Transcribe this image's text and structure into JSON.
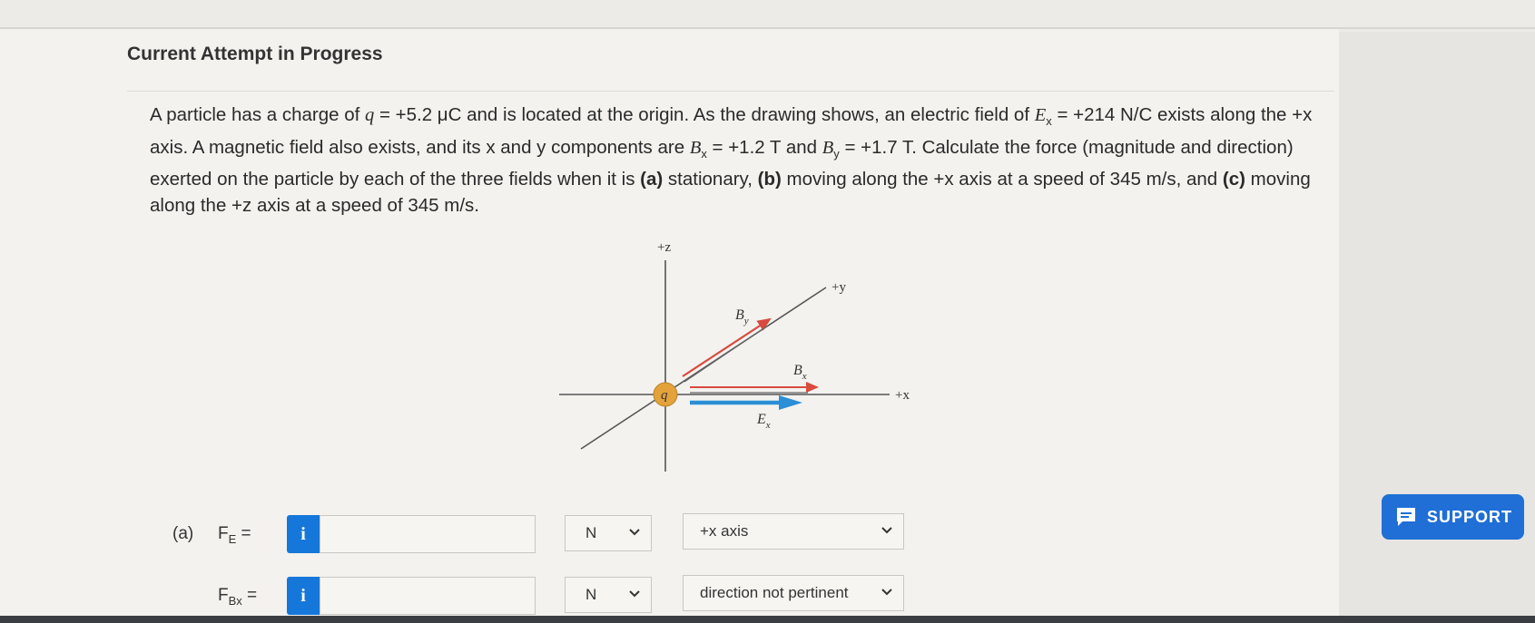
{
  "header": {
    "title": "Current Attempt in Progress"
  },
  "problem": {
    "p1": "A particle has a charge of ",
    "q_sym": "q",
    "p2": " = +5.2 μC and is located at the origin. As the drawing shows, an electric field of ",
    "E_sym": "E",
    "E_sub": "x",
    "p3": " = +214 N/C exists along the +x axis. A magnetic field also exists, and its x and y components are ",
    "Bx_sym": "B",
    "Bx_sub": "x",
    "p4": " = +1.2 T and ",
    "By_sym": "B",
    "By_sub": "y",
    "p5": " = +1.7 T. Calculate the force (magnitude and direction) exerted on the particle by each of the three fields when it is ",
    "a": "(a)",
    "p6": " stationary, ",
    "b": "(b)",
    "p7": " moving along the +x axis at a speed of 345 m/s, and ",
    "c": "(c)",
    "p8": " moving along the +z axis at a speed of 345 m/s."
  },
  "diagram": {
    "z_label": "+z",
    "y_label": "+y",
    "x_label": "+x",
    "q_label": "q",
    "By_label": "B",
    "By_sub": "y",
    "Bx_label": "B",
    "Bx_sub": "x",
    "Ex_label": "E",
    "Ex_sub": "x",
    "colors": {
      "B": "#d94b3f",
      "E": "#2a8fd6",
      "q": "#e3a23a"
    }
  },
  "answers": {
    "part_a_label": "(a)",
    "row1": {
      "label": "F",
      "sub": "E",
      "eq": " =",
      "info": "i",
      "value": "",
      "unit": "N",
      "direction": "+x axis"
    },
    "row2": {
      "label": "F",
      "sub": "Bx",
      "eq": " =",
      "info": "i",
      "value": "",
      "unit": "N",
      "direction": "direction not pertinent"
    }
  },
  "support": {
    "label": "SUPPORT"
  }
}
